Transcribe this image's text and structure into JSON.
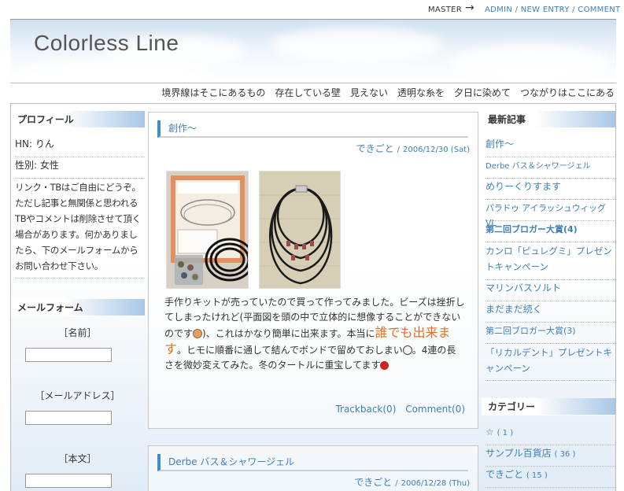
{
  "topbar": {
    "master": "MASTER",
    "arrow": "→",
    "admin": "ADMIN",
    "new_entry": "NEW ENTRY",
    "comment": "COMMENT",
    "sep": "/"
  },
  "header": {
    "title": "Colorless  Line",
    "tagline": "境界線はそこにあるもの　存在している壁　見えない　透明な糸を　夕日に染めて　つながりはここにある"
  },
  "profile": {
    "heading": "プロフィール",
    "hn": "HN: りん",
    "gender": "性別: 女性",
    "note": "リンク・TBはご自由にどうぞ。ただし記事と無関係と思われるTBやコメントは削除させて頂く場合があります。何かありましたら、下のメールフォームからお問い合わせ下さい。"
  },
  "mailform": {
    "heading": "メールフォーム",
    "name_label": "［名前］",
    "mail_label": "［メールアドレス］",
    "body_label": "［本文］"
  },
  "entries": [
    {
      "title": "創作〜",
      "category": "できごと",
      "date": "2006/12/30 (Sat)",
      "body_1": "手作りキットが売っていたので買って作ってみました。ビーズは挫折してしまったけれど(平面図を頭の中で立体的に想像することができないのです",
      "body_2": ")、これはかなり簡単に出来ます。本当に",
      "body_big": "誰でも出来ます",
      "body_3": "。ヒモに順番に通して結んでボンドで留めておしまい",
      "body_4": "。4連の長さを微妙変えてみた。冬のタートルに重宝してます",
      "trackback": "Trackback(0)",
      "comment": "Comment(0)"
    },
    {
      "title": "Derbe バス＆シャワージェル",
      "category": "できごと",
      "date": "2006/12/28 (Thu)"
    }
  ],
  "recent": {
    "heading": "最新記事",
    "items": [
      "創作〜",
      "Derbe バス＆シャワージェル",
      "めりーくりすます",
      "パラドゥ アイラッシュウィッグVL",
      "第二回ブロガー大賞(4)",
      "カンロ「ピュレグミ」プレゼントキャンペーン",
      "マリンバスソルト",
      "まだまだ続く",
      "第二回ブロガー大賞(3)",
      "「リカルデント」プレゼントキャンペーン"
    ]
  },
  "categories": {
    "heading": "カテゴリー",
    "items": [
      {
        "name": "☆",
        "count": "( 1 )"
      },
      {
        "name": "サンプル百貨店",
        "count": "( 36 )"
      },
      {
        "name": "できごと",
        "count": "( 15 )"
      }
    ]
  },
  "colors": {
    "link": "#3d7fb8",
    "accent": "#e07020",
    "head_gradient": "#a9c7e6"
  }
}
